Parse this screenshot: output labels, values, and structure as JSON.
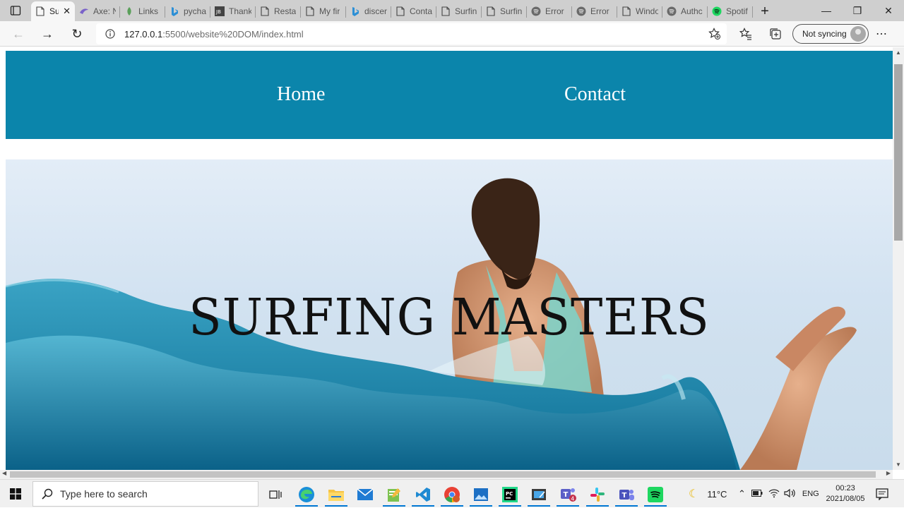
{
  "browser": {
    "tabs": [
      {
        "title": "Su",
        "icon": "page-icon",
        "active": true
      },
      {
        "title": "Axe: N",
        "icon": "axe-icon"
      },
      {
        "title": "Links ",
        "icon": "links-icon"
      },
      {
        "title": "pycha",
        "icon": "bing-icon"
      },
      {
        "title": "Thank",
        "icon": "jetbrains-icon"
      },
      {
        "title": "Resta",
        "icon": "page-icon"
      },
      {
        "title": "My fir",
        "icon": "page-icon"
      },
      {
        "title": "discer",
        "icon": "bing-icon"
      },
      {
        "title": "Conta",
        "icon": "page-icon"
      },
      {
        "title": "Surfin",
        "icon": "page-icon"
      },
      {
        "title": "Surfin",
        "icon": "page-icon"
      },
      {
        "title": "Error",
        "icon": "spotify-grey-icon"
      },
      {
        "title": "Error",
        "icon": "spotify-grey-icon"
      },
      {
        "title": "Windo",
        "icon": "page-icon"
      },
      {
        "title": "Authc",
        "icon": "spotify-grey-icon"
      },
      {
        "title": "Spotif",
        "icon": "spotify-icon"
      }
    ],
    "url_host": "127.0.0.1",
    "url_path": ":5500/website%20DOM/index.html",
    "profile_label": "Not syncing"
  },
  "page": {
    "nav": {
      "home": "Home",
      "contact": "Contact"
    },
    "hero_title": "SURFING MASTERS",
    "navbar_color": "#0b85ab"
  },
  "taskbar": {
    "search_placeholder": "Type here to search",
    "weather": "11°C",
    "language": "ENG",
    "time": "00:23",
    "date": "2021/08/05",
    "teams_badge": "4"
  }
}
